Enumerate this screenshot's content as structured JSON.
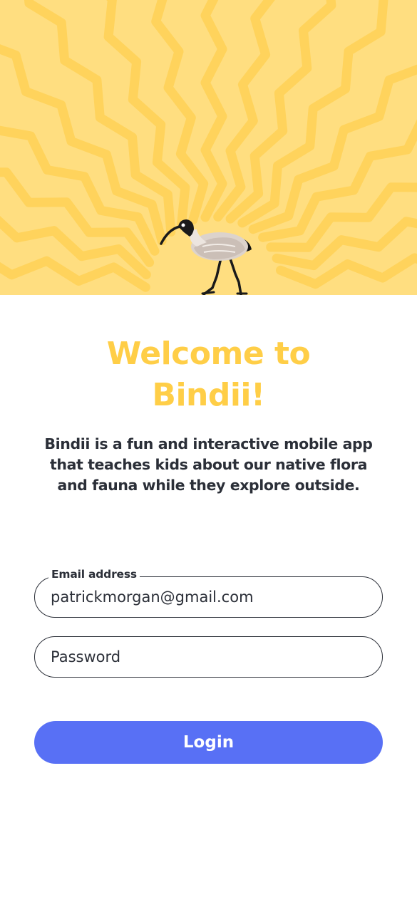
{
  "colors": {
    "hero_background": "#FFDE80",
    "sunburst_rays": "#FFD35C",
    "title": "#FFCE47",
    "body_text": "#2B2F38",
    "button": "#5870F5",
    "button_text": "#FFFFFF",
    "field_border": "#2B2F38"
  },
  "hero": {
    "illustration": "ibis-bird-on-sunburst"
  },
  "welcome": {
    "title_line1": "Welcome to",
    "title_line2": "Bindii!",
    "description": "Bindii is a fun and interactive mobile app that teaches kids about our native flora and fauna while they explore outside."
  },
  "form": {
    "email_label": "Email address",
    "email_value": "patrickmorgan@gmail.com",
    "password_placeholder": "Password",
    "password_value": "",
    "login_label": "Login"
  }
}
